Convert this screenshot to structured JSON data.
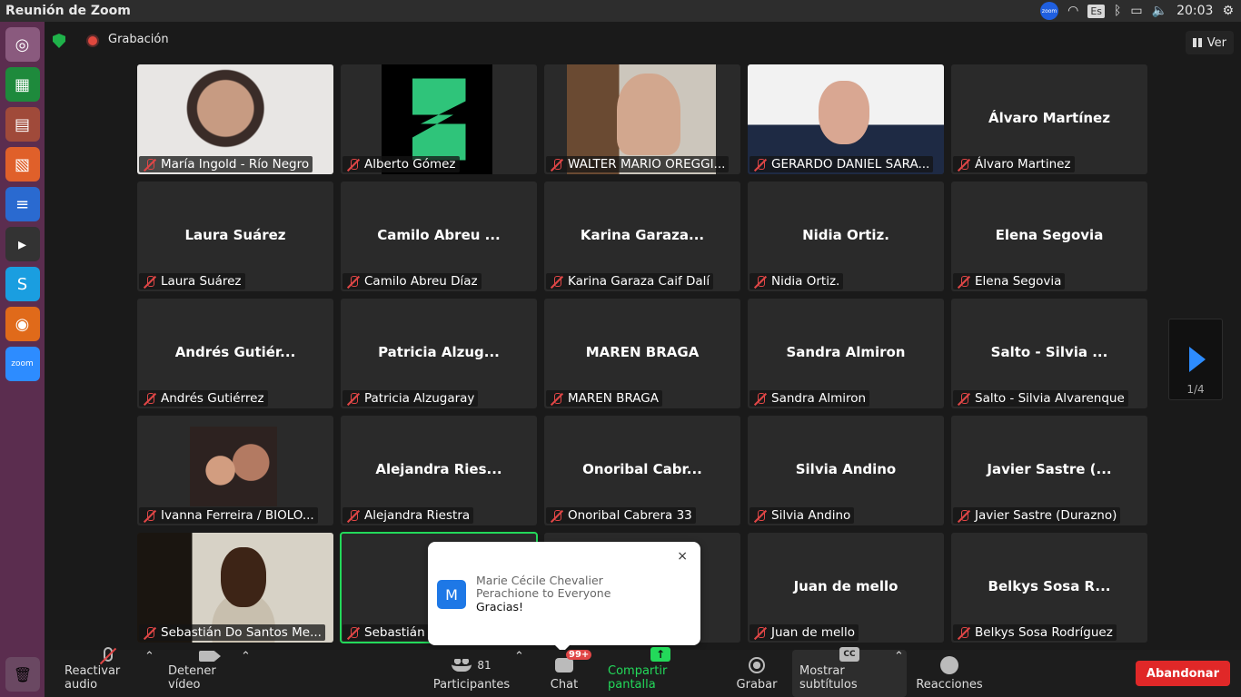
{
  "window": {
    "title": "Reunión de Zoom"
  },
  "tray": {
    "zoom_label": "zoom",
    "lang": "Es",
    "time": "20:03"
  },
  "meeting": {
    "recording_label": "Grabación",
    "view_label": "Ver",
    "page_indicator": "1/4"
  },
  "tiles": [
    {
      "center": "",
      "name": "María Ingold - Río Negro",
      "photo": "photo-1"
    },
    {
      "center": "",
      "name": "Alberto Gómez",
      "photo": "photo-2"
    },
    {
      "center": "",
      "name": "WALTER MARIO OREGGI...",
      "photo": "photo-3"
    },
    {
      "center": "",
      "name": "GERARDO DANIEL SARA...",
      "photo": "photo-4"
    },
    {
      "center": "Álvaro Martínez",
      "name": "Álvaro Martinez",
      "photo": ""
    },
    {
      "center": "Laura Suárez",
      "name": "Laura Suárez",
      "photo": ""
    },
    {
      "center": "Camilo Abreu ...",
      "name": "Camilo Abreu Díaz",
      "photo": ""
    },
    {
      "center": "Karina Garaza...",
      "name": "Karina Garaza Caif Dalí",
      "photo": ""
    },
    {
      "center": "Nidia Ortiz.",
      "name": "Nidia Ortiz.",
      "photo": ""
    },
    {
      "center": "Elena Segovia",
      "name": "Elena Segovia",
      "photo": ""
    },
    {
      "center": "Andrés Gutiér...",
      "name": "Andrés Gutiérrez",
      "photo": ""
    },
    {
      "center": "Patricia Alzug...",
      "name": "Patricia Alzugaray",
      "photo": ""
    },
    {
      "center": "MAREN BRAGA",
      "name": "MAREN BRAGA",
      "photo": ""
    },
    {
      "center": "Sandra Almiron",
      "name": "Sandra Almiron",
      "photo": ""
    },
    {
      "center": "Salto - Silvia ...",
      "name": "Salto - Silvia Alvarenque",
      "photo": ""
    },
    {
      "center": "",
      "name": "Ivanna Ferreira / BIOLO...",
      "photo": "photo-16"
    },
    {
      "center": "Alejandra Ries...",
      "name": "Alejandra Riestra",
      "photo": ""
    },
    {
      "center": "Onoribal Cabr...",
      "name": "Onoribal Cabrera 33",
      "photo": ""
    },
    {
      "center": "Silvia Andino",
      "name": "Silvia Andino",
      "photo": ""
    },
    {
      "center": "Javier Sastre (...",
      "name": "Javier Sastre (Durazno)",
      "photo": ""
    },
    {
      "center": "",
      "name": "Sebastián Do Santos Me...",
      "photo": "photo-21"
    },
    {
      "center": "",
      "name": "Sebastián",
      "photo": "",
      "speaking": true
    },
    {
      "center": "",
      "name": "",
      "photo": ""
    },
    {
      "center": "Juan de mello",
      "name": "Juan de mello",
      "photo": ""
    },
    {
      "center": "Belkys Sosa R...",
      "name": "Belkys Sosa Rodríguez",
      "photo": ""
    }
  ],
  "chat_popup": {
    "avatar_letter": "M",
    "sender": "Marie Cécile Chevalier Perachione to Everyone",
    "message": "Gracias!",
    "close": "×"
  },
  "toolbar": {
    "unmute_label": "Reactivar audio",
    "stop_video_label": "Detener vídeo",
    "participants_label": "Participantes",
    "participants_count": "81",
    "chat_label": "Chat",
    "chat_badge": "99+",
    "share_label": "Compartir pantalla",
    "record_label": "Grabar",
    "subtitles_label": "Mostrar subtítulos",
    "subtitles_icon": "CC",
    "reactions_label": "Reacciones",
    "leave_label": "Abandonar"
  },
  "colors": {
    "accent": "#2d8cff",
    "share_green": "#23d95a",
    "leave_red": "#e02828"
  }
}
